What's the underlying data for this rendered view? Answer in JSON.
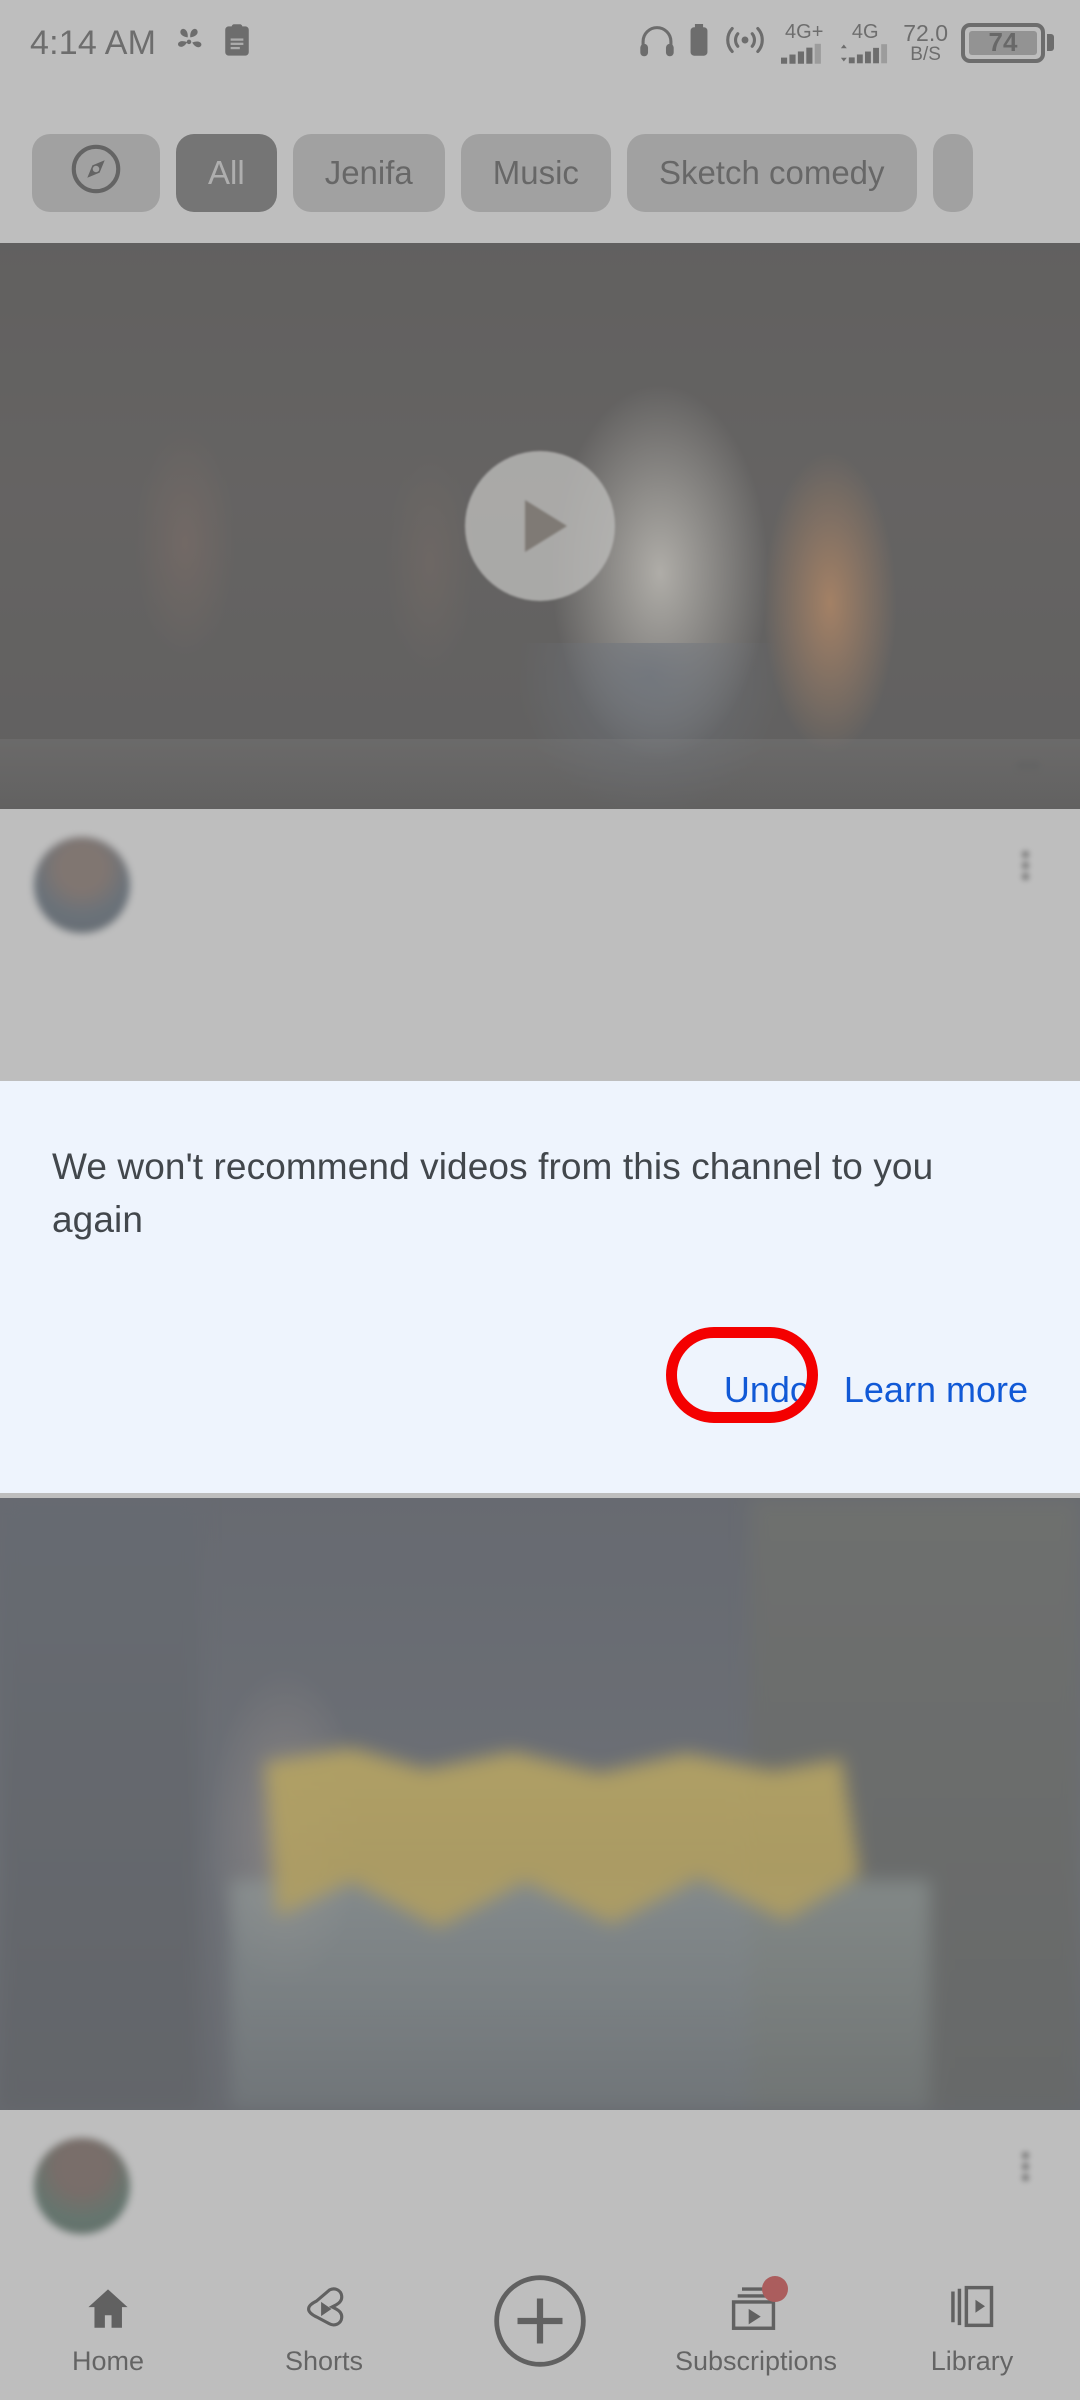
{
  "status_bar": {
    "clock": "4:14 AM",
    "left_icons": [
      "pinwheel-icon",
      "clipboard-icon"
    ],
    "right_icons": [
      "headphone-icon",
      "battery-small-icon",
      "hotspot-icon"
    ],
    "network_1": "4G+",
    "network_2": "4G",
    "data_speed_value": "72.0",
    "data_speed_unit": "B/S",
    "battery_percent": "74"
  },
  "chips": {
    "explore_icon": "compass-icon",
    "items": [
      {
        "label": "All",
        "selected": true
      },
      {
        "label": "Jenifa",
        "selected": false
      },
      {
        "label": "Music",
        "selected": false
      },
      {
        "label": "Sketch comedy",
        "selected": false
      }
    ]
  },
  "feed": {
    "video_1": {
      "play_icon": "play-circle-icon",
      "duration": "",
      "title": "",
      "subtitle": "",
      "more_icon": "more-vertical-icon"
    },
    "video_2": {
      "title": "",
      "subtitle": "",
      "more_icon": "more-vertical-icon"
    }
  },
  "snackbar": {
    "message": "We won't recommend videos from this channel to you again",
    "undo_label": "Undo",
    "learn_more_label": "Learn more",
    "background_color": "#eef4fd",
    "link_color": "#1159d6"
  },
  "annotation": {
    "shape": "ellipse",
    "color": "#f40000",
    "target": "Undo"
  },
  "bottom_nav": {
    "items": [
      {
        "label": "Home",
        "icon": "home-icon",
        "active": true,
        "badge": false
      },
      {
        "label": "Shorts",
        "icon": "shorts-icon",
        "active": false,
        "badge": false
      },
      {
        "label": "",
        "icon": "plus-circle-icon",
        "active": false,
        "badge": false
      },
      {
        "label": "Subscriptions",
        "icon": "subscriptions-icon",
        "active": false,
        "badge": true
      },
      {
        "label": "Library",
        "icon": "library-icon",
        "active": false,
        "badge": false
      }
    ]
  }
}
